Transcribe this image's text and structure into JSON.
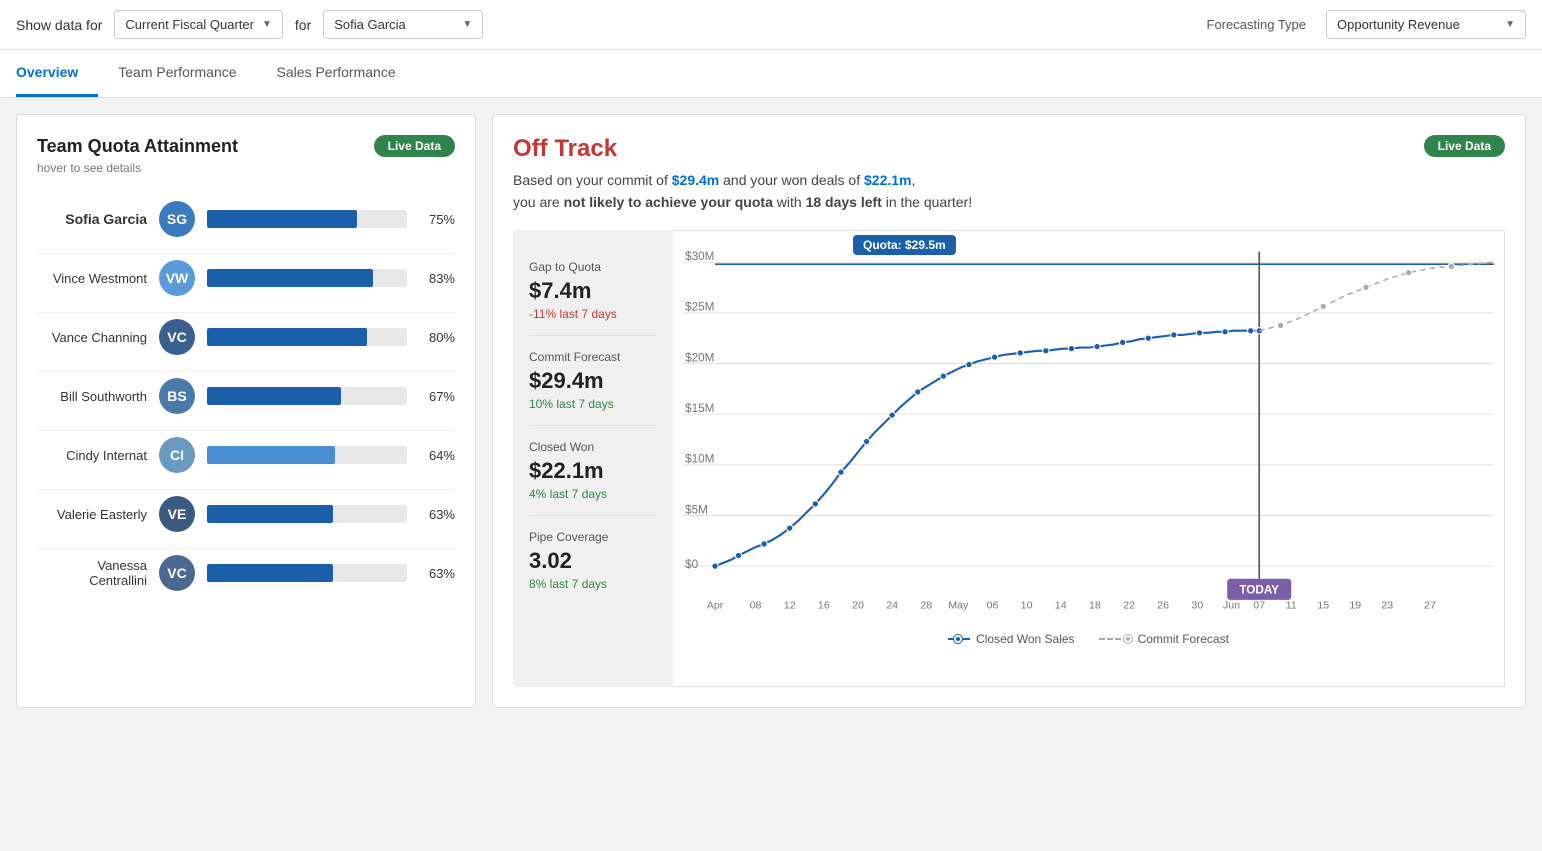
{
  "header": {
    "show_data_label": "Show data for",
    "period_dropdown": "Current Fiscal Quarter",
    "for_label": "for",
    "person_dropdown": "Sofia Garcia",
    "forecasting_label": "Forecasting Type",
    "forecasting_type": "Opportunity Revenue"
  },
  "tabs": [
    {
      "id": "overview",
      "label": "Overview",
      "active": true
    },
    {
      "id": "team",
      "label": "Team Performance",
      "active": false
    },
    {
      "id": "sales",
      "label": "Sales Performance",
      "active": false
    }
  ],
  "left_panel": {
    "title": "Team Quota Attainment",
    "live_badge": "Live Data",
    "hover_hint": "hover to see details",
    "members": [
      {
        "name": "Sofia Garcia",
        "pct": 75,
        "pct_label": "75%",
        "bold": true,
        "color": "#1b5faa"
      },
      {
        "name": "Vince Westmont",
        "pct": 83,
        "pct_label": "83%",
        "bold": false,
        "color": "#1b5faa"
      },
      {
        "name": "Vance Channing",
        "pct": 80,
        "pct_label": "80%",
        "bold": false,
        "color": "#1b5faa"
      },
      {
        "name": "Bill Southworth",
        "pct": 67,
        "pct_label": "67%",
        "bold": false,
        "color": "#1b5faa"
      },
      {
        "name": "Cindy Internat",
        "pct": 64,
        "pct_label": "64%",
        "bold": false,
        "color": "#4a8fd4"
      },
      {
        "name": "Valerie Easterly",
        "pct": 63,
        "pct_label": "63%",
        "bold": false,
        "color": "#1b5faa"
      },
      {
        "name": "Vanessa Centrallini",
        "pct": 63,
        "pct_label": "63%",
        "bold": false,
        "color": "#1b5faa"
      }
    ]
  },
  "right_panel": {
    "live_badge": "Live Data",
    "status": "Off Track",
    "description_1": "Based on your commit of ",
    "commit_value": "$29.4m",
    "description_2": " and your won deals of ",
    "won_value": "$22.1m",
    "description_3": ",",
    "description_4": "you are ",
    "bold_phrase": "not likely to achieve your quota",
    "description_5": " with ",
    "days_bold": "18 days left",
    "description_6": " in the quarter!",
    "metrics": [
      {
        "label": "Gap to Quota",
        "value": "$7.4m",
        "change": "-11%",
        "change_note": "last 7 days",
        "change_type": "negative"
      },
      {
        "label": "Commit Forecast",
        "value": "$29.4m",
        "change": "10%",
        "change_note": "last 7 days",
        "change_type": "positive"
      },
      {
        "label": "Closed Won",
        "value": "$22.1m",
        "change": "4%",
        "change_note": "last 7 days",
        "change_type": "positive"
      },
      {
        "label": "Pipe Coverage",
        "value": "3.02",
        "change": "8%",
        "change_note": "last 7 days",
        "change_type": "positive"
      }
    ],
    "chart": {
      "quota_label": "Quota: $29.5m",
      "today_label": "TODAY",
      "y_labels": [
        "$30m",
        "$25m",
        "$20m",
        "$15m",
        "$10m",
        "$5m",
        "$0"
      ],
      "x_labels": [
        "Apr",
        "08",
        "12",
        "16",
        "20",
        "24",
        "28",
        "May",
        "06",
        "10",
        "14",
        "18",
        "22",
        "26",
        "30",
        "Jun",
        "07",
        "11",
        "15",
        "19",
        "23",
        "27"
      ]
    },
    "legend": {
      "item1": "Closed Won Sales",
      "item2": "Commit Forecast"
    }
  }
}
